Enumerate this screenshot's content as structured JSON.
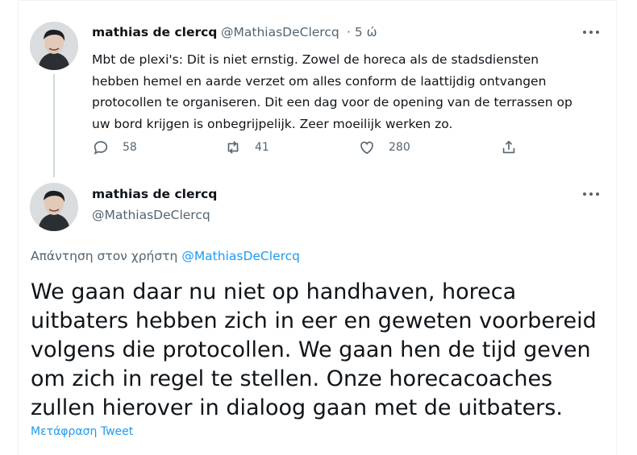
{
  "tweet1": {
    "author_name": "mathias de clercq",
    "handle": "@MathiasDeClercq",
    "time": "· 5 ώ",
    "text": "Mbt de plexi's: Dit is niet ernstig. Zowel de horeca als de stadsdiensten hebben hemel en aarde verzet om alles conform de laattijdig ontvangen protocollen te organiseren. Dit een dag voor de opening van de terrassen op uw bord krijgen is onbegrijpelijk. Zeer moeilijk werken zo.",
    "replies": "58",
    "retweets": "41",
    "likes": "280"
  },
  "tweet2": {
    "author_name": "mathias de clercq",
    "handle": "@MathiasDeClercq",
    "reply_prefix": "Απάντηση στον χρήστη",
    "reply_handle": "@MathiasDeClercq",
    "text": "We gaan daar nu niet op handhaven, horeca uitbaters hebben zich in eer en geweten voorbereid volgens die protocollen. We gaan hen de tijd geven om zich in regel te stellen. Onze horecacoaches zullen hierover in dialoog gaan met de uitbaters.",
    "translate_label": "Μετάφραση Tweet"
  },
  "colors": {
    "primary_text": "#0f1419",
    "secondary_text": "#536471",
    "link": "#1d9bf0",
    "thread_line": "#cfd9de"
  },
  "icons": [
    "reply-icon",
    "retweet-icon",
    "like-icon",
    "share-icon",
    "more-icon"
  ]
}
